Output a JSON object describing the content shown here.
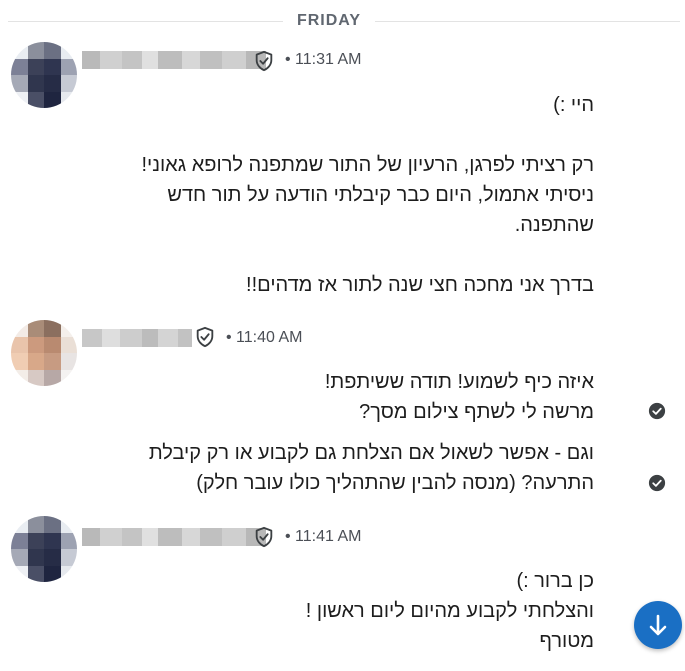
{
  "divider": {
    "label": "FRIDAY"
  },
  "messages": [
    {
      "time": "• 11:31 AM",
      "lines": [
        "היי :)",
        "",
        "רק רציתי לפרגן, הרעיון של התור שמתפנה לרופא גאוני!",
        "ניסיתי אתמול, היום כבר קיבלתי הודעה על תור חדש",
        "שהתפנה.",
        "",
        "בדרך אני מחכה חצי שנה לתור אז מדהים!!"
      ]
    },
    {
      "time": "• 11:40 AM",
      "replies": [
        {
          "lines": [
            "איזה כיף לשמוע! תודה ששיתפת!",
            "מרשה לי לשתף צילום מסך?"
          ],
          "status_icon": "check-circle-icon"
        },
        {
          "lines": [
            "וגם - אפשר לשאול אם הצלחת גם לקבוע או רק קיבלת",
            "התרעה? (מנסה להבין שהתהליך כולו עובר חלק)"
          ],
          "status_icon": "check-circle-icon"
        }
      ]
    },
    {
      "time": "• 11:41 AM",
      "lines": [
        "כן ברור :)",
        "והצלחתי לקבוע מהיום ליום ראשון !",
        "מטורף"
      ]
    }
  ],
  "colors": {
    "fab": "#1a6fc4",
    "check": "#3c4043",
    "divider_text": "#606770"
  },
  "scroll_button": {
    "icon": "arrow-down-icon"
  }
}
